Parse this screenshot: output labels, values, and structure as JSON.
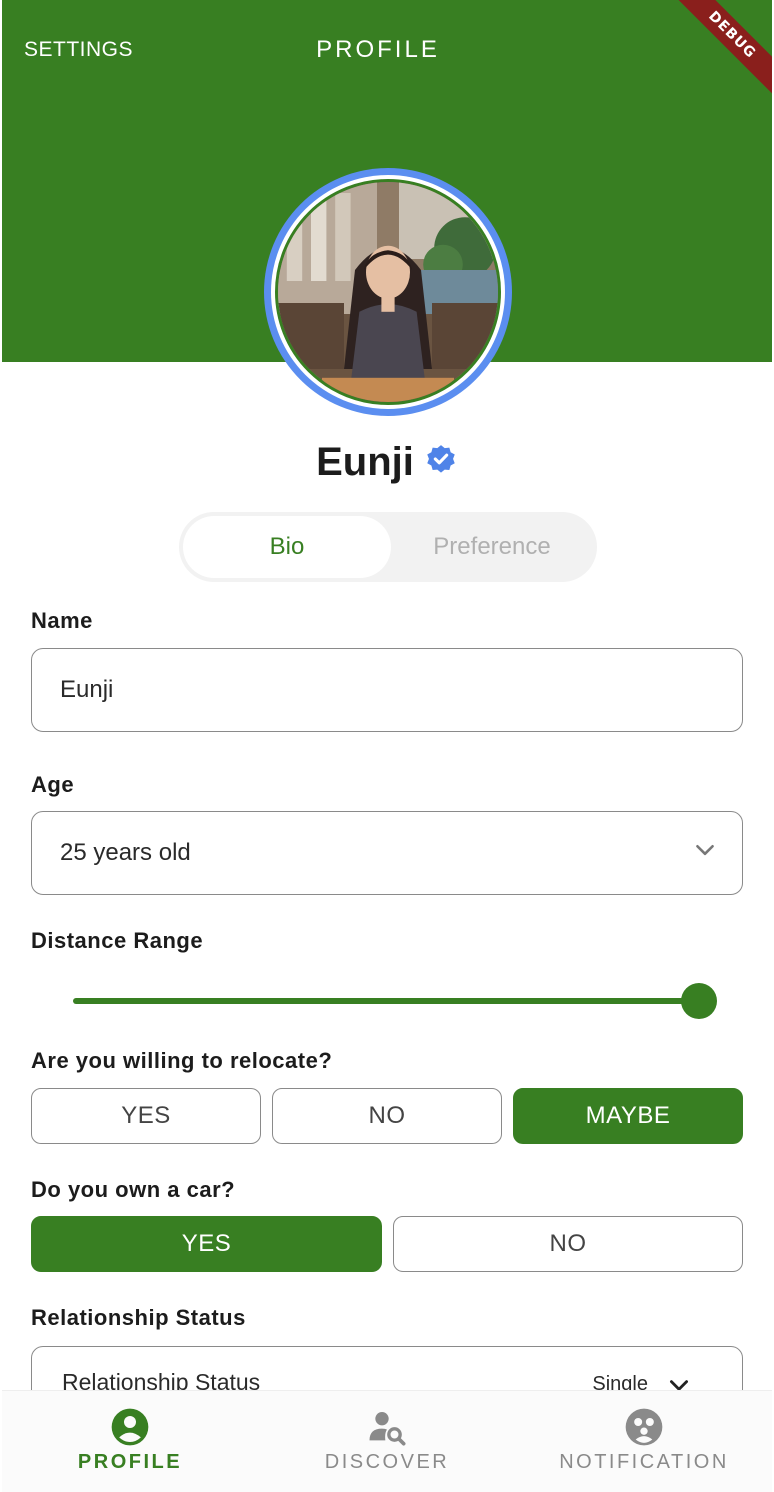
{
  "colors": {
    "primary": "#387f22",
    "ring": "#5b8ef0",
    "verified": "#4f83e8",
    "debug": "#8a1f1c"
  },
  "header": {
    "settings_label": "SETTINGS",
    "title": "PROFILE",
    "debug_banner": "DEBUG"
  },
  "profile": {
    "name": "Eunji",
    "verified_icon": "verified-badge-icon"
  },
  "tabs": {
    "bio": "Bio",
    "preference": "Preference",
    "active": "Bio"
  },
  "form": {
    "name": {
      "label": "Name",
      "value": "Eunji"
    },
    "age": {
      "label": "Age",
      "value": "25 years old"
    },
    "distance": {
      "label": "Distance Range",
      "level": 1.0
    },
    "relocate": {
      "label": "Are you willing to relocate?",
      "options": [
        "YES",
        "NO",
        "MAYBE"
      ],
      "selected": "MAYBE"
    },
    "car": {
      "label": "Do you own a car?",
      "options": [
        "YES",
        "NO"
      ],
      "selected": "YES"
    },
    "relationship": {
      "label": "Relationship Status",
      "field_label": "Relationship Status",
      "value": "Single"
    }
  },
  "bottom_nav": [
    {
      "label": "PROFILE",
      "icon": "person-circle-icon",
      "active": true
    },
    {
      "label": "DISCOVER",
      "icon": "person-search-icon",
      "active": false
    },
    {
      "label": "NOTIFICATION",
      "icon": "group-circle-icon",
      "active": false
    }
  ]
}
